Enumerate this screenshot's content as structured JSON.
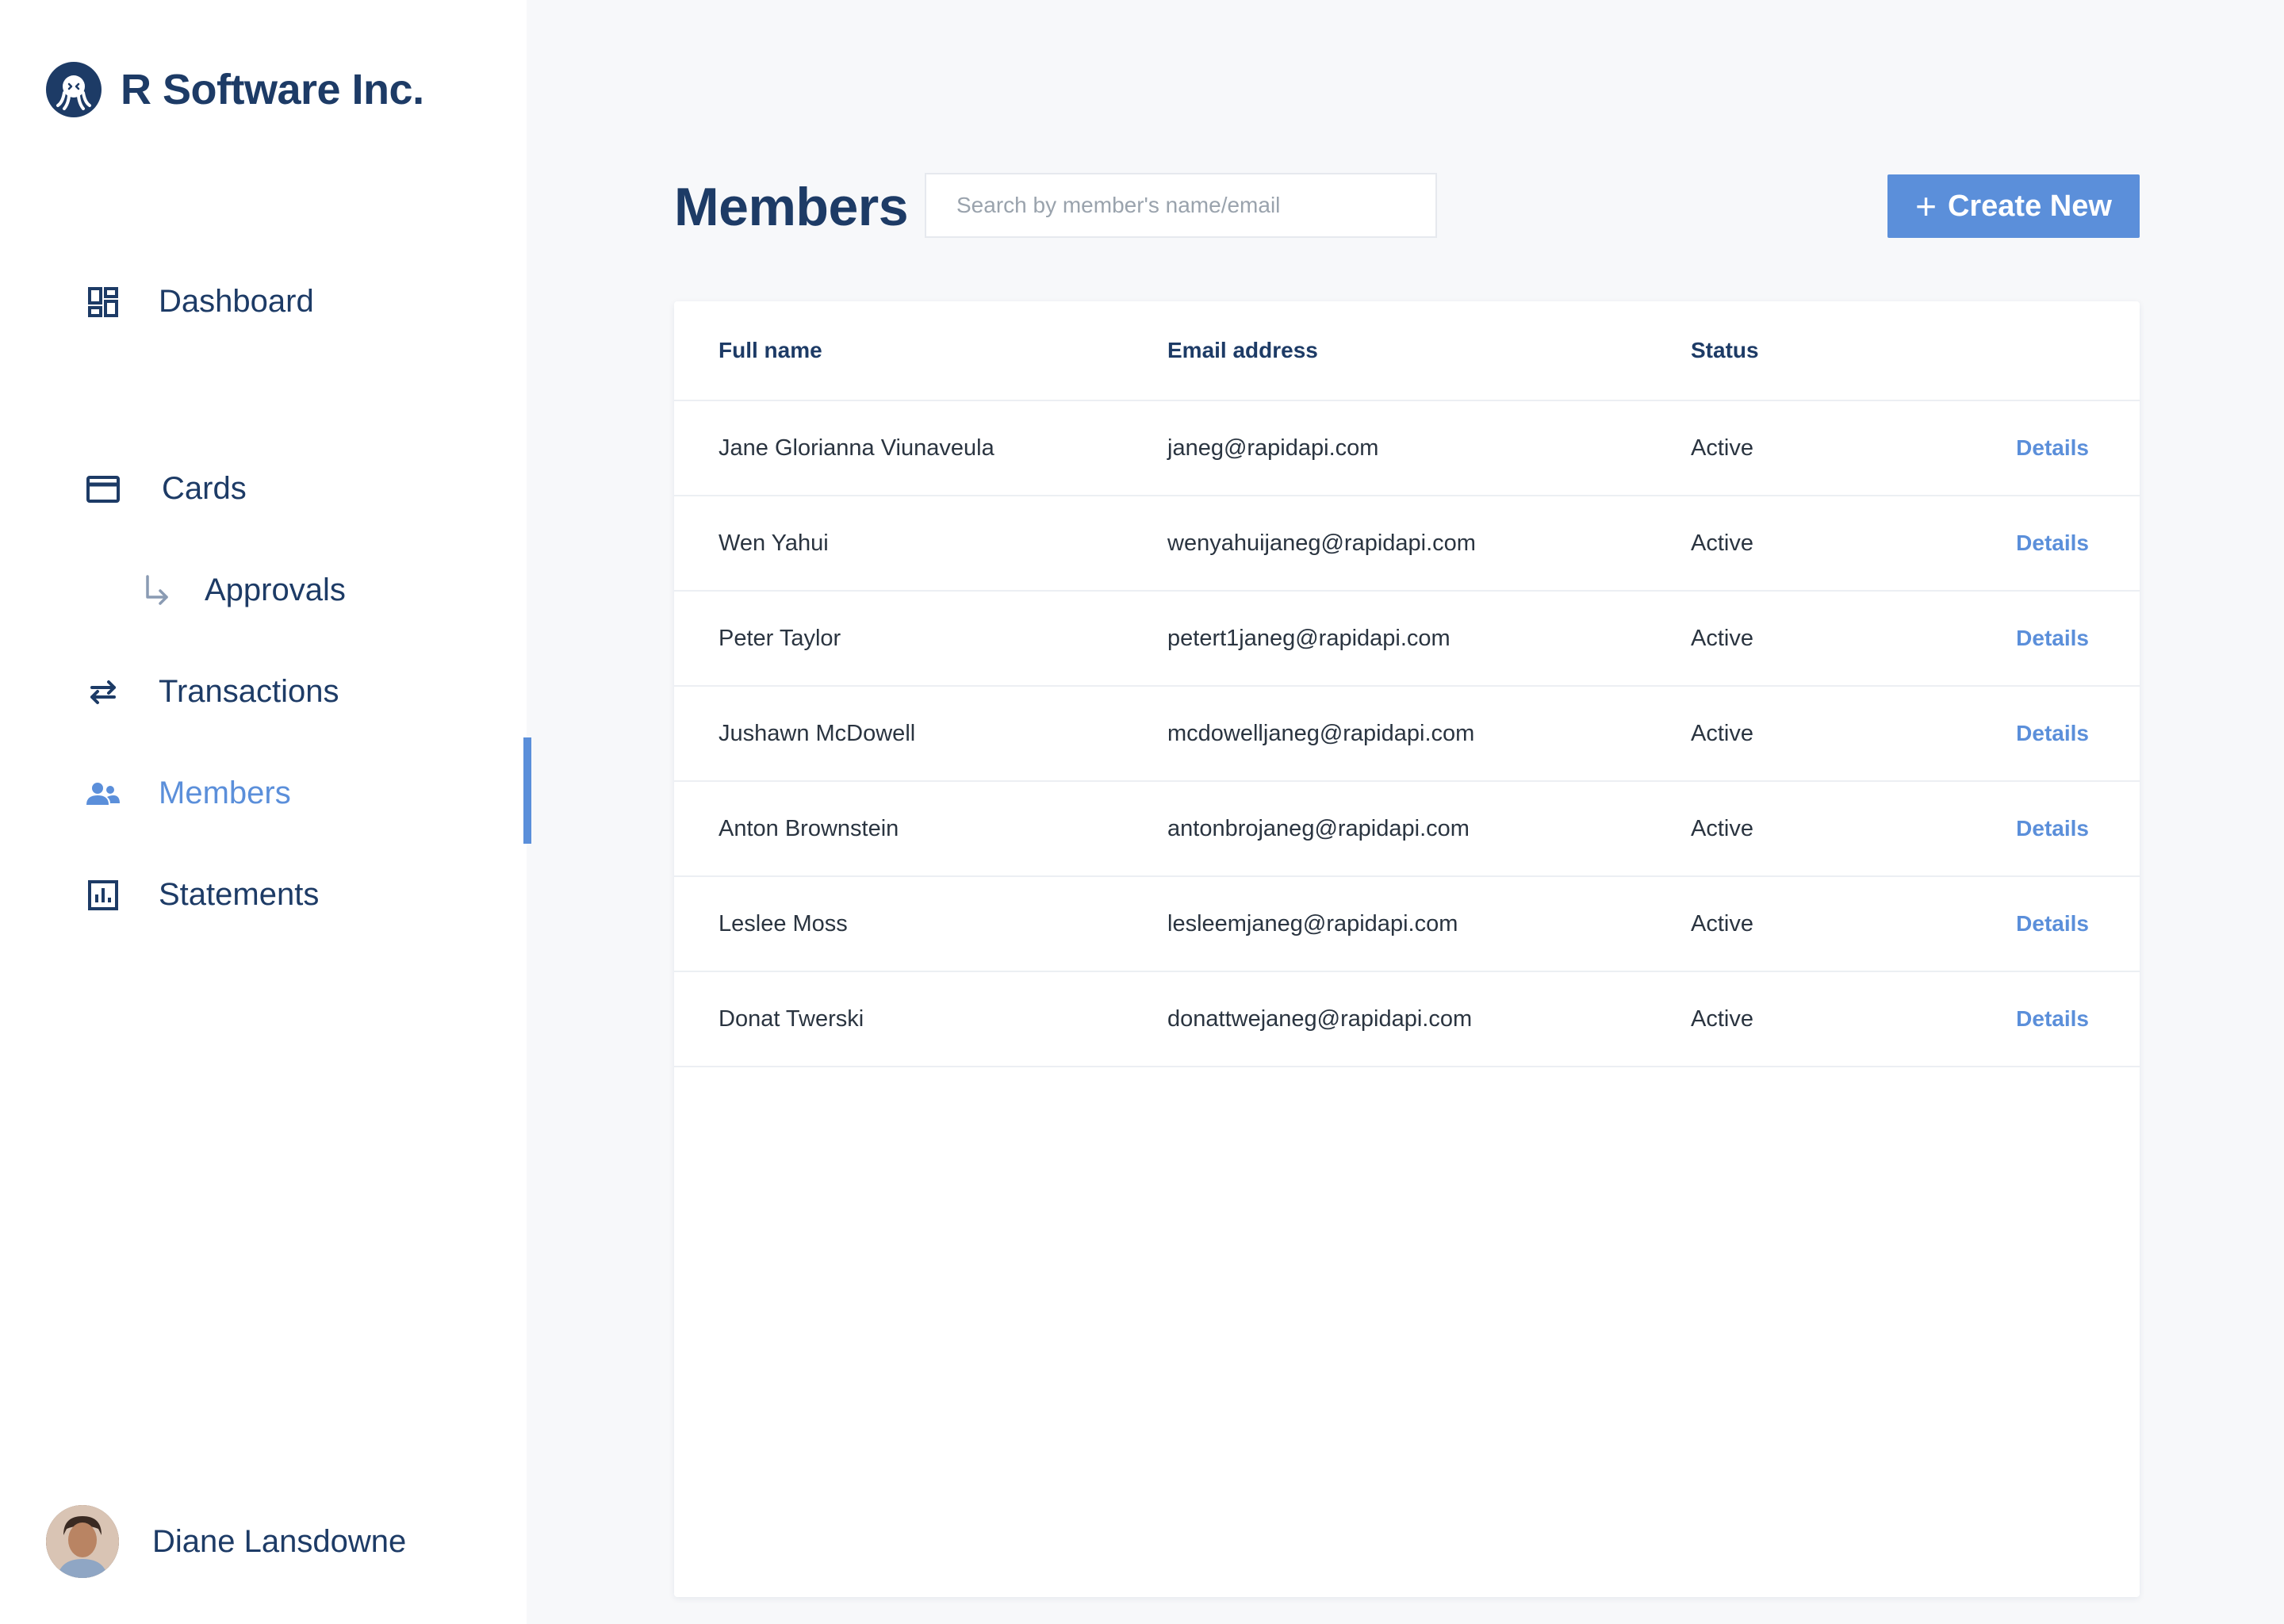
{
  "brand": {
    "name": "R Software Inc.",
    "logo_icon": "octopus-logo-icon"
  },
  "sidebar": {
    "items": [
      {
        "label": "Dashboard",
        "icon": "dashboard-icon"
      },
      {
        "label": "Cards",
        "icon": "credit-card-icon"
      },
      {
        "label": "Approvals",
        "icon": "subdirectory-arrow-icon"
      },
      {
        "label": "Transactions",
        "icon": "swap-arrows-icon"
      },
      {
        "label": "Members",
        "icon": "people-icon",
        "active": true
      },
      {
        "label": "Statements",
        "icon": "bar-chart-icon"
      }
    ],
    "active_color": "#5b8fda"
  },
  "user": {
    "name": "Diane Lansdowne"
  },
  "page": {
    "title": "Members",
    "search_placeholder": "Search by member's name/email",
    "search_value": "",
    "create_label": "Create New"
  },
  "table": {
    "headers": {
      "name": "Full name",
      "email": "Email address",
      "status": "Status"
    },
    "rows": [
      {
        "name": "Jane Glorianna Viunaveula",
        "email": "janeg@rapidapi.com",
        "status": "Active",
        "action": "Details"
      },
      {
        "name": "Wen Yahui",
        "email": "wenyahuijaneg@rapidapi.com",
        "status": "Active",
        "action": "Details"
      },
      {
        "name": "Peter Taylor",
        "email": "petert1janeg@rapidapi.com",
        "status": "Active",
        "action": "Details"
      },
      {
        "name": "Jushawn McDowell",
        "email": "mcdowelljaneg@rapidapi.com",
        "status": "Active",
        "action": "Details"
      },
      {
        "name": "Anton Brownstein",
        "email": "antonbrojaneg@rapidapi.com",
        "status": "Active",
        "action": "Details"
      },
      {
        "name": "Leslee Moss",
        "email": "lesleemjaneg@rapidapi.com",
        "status": "Active",
        "action": "Details"
      },
      {
        "name": "Donat Twerski",
        "email": "donattwejaneg@rapidapi.com",
        "status": "Active",
        "action": "Details"
      }
    ]
  },
  "colors": {
    "primary": "#1d3b66",
    "accent": "#5b8fda",
    "background": "#f7f8fa"
  }
}
